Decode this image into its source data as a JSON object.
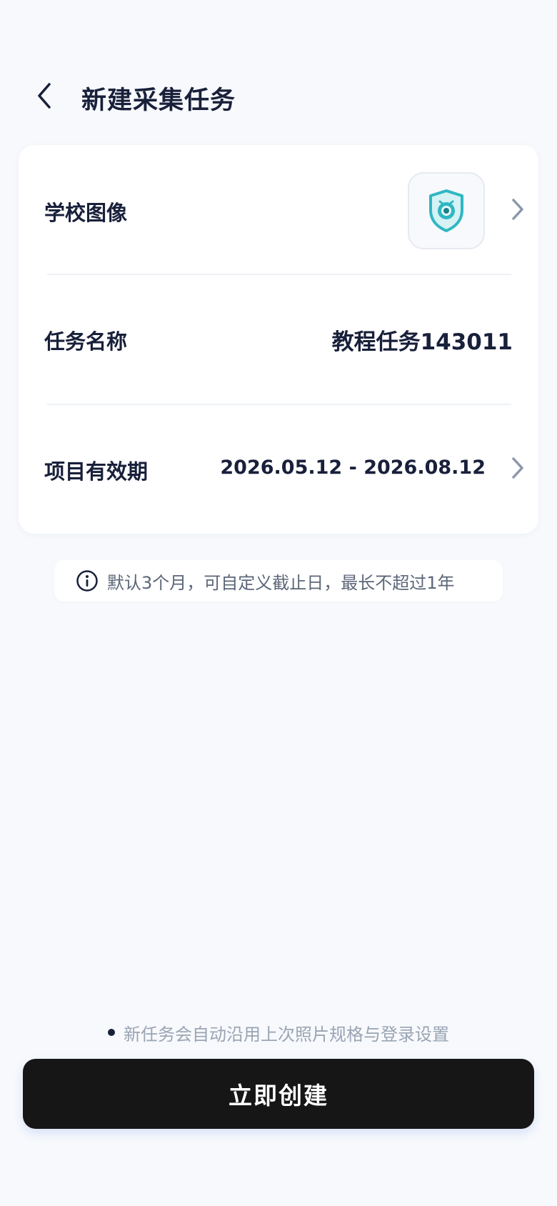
{
  "header": {
    "title": "新建采集任务",
    "back_icon": "chevron-left-icon"
  },
  "form": {
    "school_image": {
      "label": "学校图像",
      "logo_icon": "shield-camera-logo-icon",
      "chevron_icon": "chevron-right-icon"
    },
    "task_name": {
      "label": "任务名称",
      "value": "教程任务143011"
    },
    "validity": {
      "label": "项目有效期",
      "value": "2026.05.12 - 2026.08.12",
      "chevron_icon": "chevron-right-icon"
    }
  },
  "hint": {
    "icon": "info-icon",
    "text": "默认3个月，可自定义截止日，最长不超过1年"
  },
  "note": {
    "text": "新任务会自动沿用上次照片规格与登录设置"
  },
  "actions": {
    "create_label": "立即创建"
  },
  "colors": {
    "background": "#f7f9fc",
    "card": "#ffffff",
    "text_primary": "#18203a",
    "text_muted": "#9aa4b3",
    "button": "#161616",
    "logo_teal": "#2fb7c3",
    "chevron": "#8c97aa"
  }
}
